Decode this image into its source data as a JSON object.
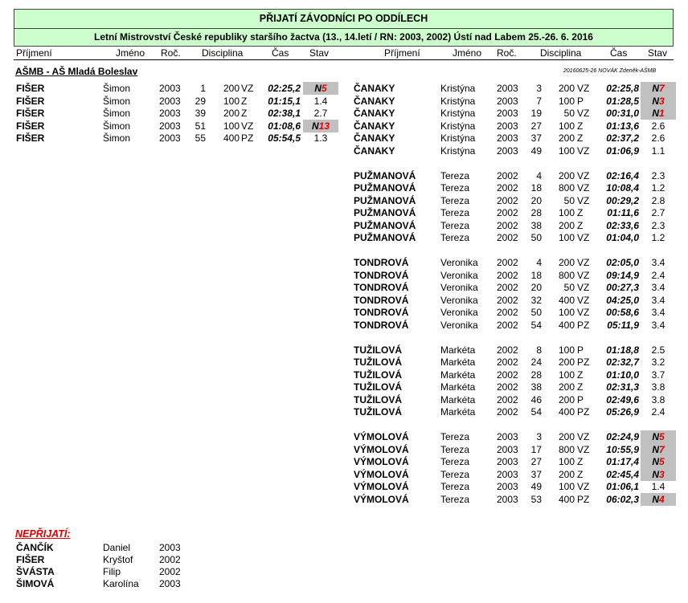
{
  "title": "PŘIJATÍ ZÁVODNÍCI PO ODDÍLECH",
  "subtitle": "Letní Mistrovství České republiky staršího žactva (13., 14.letí  / RN: 2003, 2002)   Ústí nad Labem 25.-26. 6. 2016",
  "columns": {
    "surname": "Příjmení",
    "name": "Jméno",
    "year": "Roč.",
    "discipline": "Disciplina",
    "time": "Čas",
    "status": "Stav"
  },
  "club": {
    "name": "AŠMB - AŠ Mladá Boleslav",
    "meta": "20160625-26 NOVÁK Zdeněk-AŠMB"
  },
  "left_entries": [
    {
      "surname": "FIŠER",
      "name": "Šimon",
      "year": "2003",
      "num": "1",
      "dist": "200",
      "stroke": "VZ",
      "time": "02:25,2",
      "status": {
        "type": "N",
        "prefix": "N",
        "rank": "5"
      }
    },
    {
      "surname": "FIŠER",
      "name": "Šimon",
      "year": "2003",
      "num": "29",
      "dist": "100",
      "stroke": "Z",
      "time": "01:15,1",
      "status": {
        "type": "val",
        "text": "1.4"
      }
    },
    {
      "surname": "FIŠER",
      "name": "Šimon",
      "year": "2003",
      "num": "39",
      "dist": "200",
      "stroke": "Z",
      "time": "02:38,1",
      "status": {
        "type": "val",
        "text": "2.7"
      }
    },
    {
      "surname": "FIŠER",
      "name": "Šimon",
      "year": "2003",
      "num": "51",
      "dist": "100",
      "stroke": "VZ",
      "time": "01:08,6",
      "status": {
        "type": "N",
        "prefix": "N",
        "rank": "13"
      }
    },
    {
      "surname": "FIŠER",
      "name": "Šimon",
      "year": "2003",
      "num": "55",
      "dist": "400",
      "stroke": "PZ",
      "time": "05:54,5",
      "status": {
        "type": "val",
        "text": "1.3"
      }
    }
  ],
  "right_groups": [
    {
      "entries": [
        {
          "surname": "ČANAKY",
          "name": "Kristýna",
          "year": "2003",
          "num": "3",
          "dist": "200",
          "stroke": "VZ",
          "time": "02:25,8",
          "status": {
            "type": "N",
            "prefix": "N",
            "rank": "7"
          }
        },
        {
          "surname": "ČANAKY",
          "name": "Kristýna",
          "year": "2003",
          "num": "7",
          "dist": "100",
          "stroke": "P",
          "time": "01:28,5",
          "status": {
            "type": "N",
            "prefix": "N",
            "rank": "3"
          }
        },
        {
          "surname": "ČANAKY",
          "name": "Kristýna",
          "year": "2003",
          "num": "19",
          "dist": "50",
          "stroke": "VZ",
          "time": "00:31,0",
          "status": {
            "type": "N",
            "prefix": "N",
            "rank": "1"
          }
        },
        {
          "surname": "ČANAKY",
          "name": "Kristýna",
          "year": "2003",
          "num": "27",
          "dist": "100",
          "stroke": "Z",
          "time": "01:13,6",
          "status": {
            "type": "val",
            "text": "2.6"
          }
        },
        {
          "surname": "ČANAKY",
          "name": "Kristýna",
          "year": "2003",
          "num": "37",
          "dist": "200",
          "stroke": "Z",
          "time": "02:37,2",
          "status": {
            "type": "val",
            "text": "2.6"
          }
        },
        {
          "surname": "ČANAKY",
          "name": "Kristýna",
          "year": "2003",
          "num": "49",
          "dist": "100",
          "stroke": "VZ",
          "time": "01:06,9",
          "status": {
            "type": "val",
            "text": "1.1"
          }
        }
      ]
    },
    {
      "entries": [
        {
          "surname": "PUŽMANOVÁ",
          "name": "Tereza",
          "year": "2002",
          "num": "4",
          "dist": "200",
          "stroke": "VZ",
          "time": "02:16,4",
          "status": {
            "type": "val",
            "text": "2.3"
          }
        },
        {
          "surname": "PUŽMANOVÁ",
          "name": "Tereza",
          "year": "2002",
          "num": "18",
          "dist": "800",
          "stroke": "VZ",
          "time": "10:08,4",
          "status": {
            "type": "val",
            "text": "1.2"
          }
        },
        {
          "surname": "PUŽMANOVÁ",
          "name": "Tereza",
          "year": "2002",
          "num": "20",
          "dist": "50",
          "stroke": "VZ",
          "time": "00:29,2",
          "status": {
            "type": "val",
            "text": "2.8"
          }
        },
        {
          "surname": "PUŽMANOVÁ",
          "name": "Tereza",
          "year": "2002",
          "num": "28",
          "dist": "100",
          "stroke": "Z",
          "time": "01:11,6",
          "status": {
            "type": "val",
            "text": "2.7"
          }
        },
        {
          "surname": "PUŽMANOVÁ",
          "name": "Tereza",
          "year": "2002",
          "num": "38",
          "dist": "200",
          "stroke": "Z",
          "time": "02:33,6",
          "status": {
            "type": "val",
            "text": "2.3"
          }
        },
        {
          "surname": "PUŽMANOVÁ",
          "name": "Tereza",
          "year": "2002",
          "num": "50",
          "dist": "100",
          "stroke": "VZ",
          "time": "01:04,0",
          "status": {
            "type": "val",
            "text": "1.2"
          }
        }
      ]
    },
    {
      "entries": [
        {
          "surname": "TONDROVÁ",
          "name": "Veronika",
          "year": "2002",
          "num": "4",
          "dist": "200",
          "stroke": "VZ",
          "time": "02:05,0",
          "status": {
            "type": "val",
            "text": "3.4"
          }
        },
        {
          "surname": "TONDROVÁ",
          "name": "Veronika",
          "year": "2002",
          "num": "18",
          "dist": "800",
          "stroke": "VZ",
          "time": "09:14,9",
          "status": {
            "type": "val",
            "text": "2.4"
          }
        },
        {
          "surname": "TONDROVÁ",
          "name": "Veronika",
          "year": "2002",
          "num": "20",
          "dist": "50",
          "stroke": "VZ",
          "time": "00:27,3",
          "status": {
            "type": "val",
            "text": "3.4"
          }
        },
        {
          "surname": "TONDROVÁ",
          "name": "Veronika",
          "year": "2002",
          "num": "32",
          "dist": "400",
          "stroke": "VZ",
          "time": "04:25,0",
          "status": {
            "type": "val",
            "text": "3.4"
          }
        },
        {
          "surname": "TONDROVÁ",
          "name": "Veronika",
          "year": "2002",
          "num": "50",
          "dist": "100",
          "stroke": "VZ",
          "time": "00:58,6",
          "status": {
            "type": "val",
            "text": "3.4"
          }
        },
        {
          "surname": "TONDROVÁ",
          "name": "Veronika",
          "year": "2002",
          "num": "54",
          "dist": "400",
          "stroke": "PZ",
          "time": "05:11,9",
          "status": {
            "type": "val",
            "text": "3.4"
          }
        }
      ]
    },
    {
      "entries": [
        {
          "surname": "TUŽILOVÁ",
          "name": "Markéta",
          "year": "2002",
          "num": "8",
          "dist": "100",
          "stroke": "P",
          "time": "01:18,8",
          "status": {
            "type": "val",
            "text": "2.5"
          }
        },
        {
          "surname": "TUŽILOVÁ",
          "name": "Markéta",
          "year": "2002",
          "num": "24",
          "dist": "200",
          "stroke": "PZ",
          "time": "02:32,7",
          "status": {
            "type": "val",
            "text": "3.2"
          }
        },
        {
          "surname": "TUŽILOVÁ",
          "name": "Markéta",
          "year": "2002",
          "num": "28",
          "dist": "100",
          "stroke": "Z",
          "time": "01:10,0",
          "status": {
            "type": "val",
            "text": "3.7"
          }
        },
        {
          "surname": "TUŽILOVÁ",
          "name": "Markéta",
          "year": "2002",
          "num": "38",
          "dist": "200",
          "stroke": "Z",
          "time": "02:31,3",
          "status": {
            "type": "val",
            "text": "3.8"
          }
        },
        {
          "surname": "TUŽILOVÁ",
          "name": "Markéta",
          "year": "2002",
          "num": "46",
          "dist": "200",
          "stroke": "P",
          "time": "02:49,6",
          "status": {
            "type": "val",
            "text": "3.8"
          }
        },
        {
          "surname": "TUŽILOVÁ",
          "name": "Markéta",
          "year": "2002",
          "num": "54",
          "dist": "400",
          "stroke": "PZ",
          "time": "05:26,9",
          "status": {
            "type": "val",
            "text": "2.4"
          }
        }
      ]
    },
    {
      "entries": [
        {
          "surname": "VÝMOLOVÁ",
          "name": "Tereza",
          "year": "2003",
          "num": "3",
          "dist": "200",
          "stroke": "VZ",
          "time": "02:24,9",
          "status": {
            "type": "N",
            "prefix": "N",
            "rank": "5"
          }
        },
        {
          "surname": "VÝMOLOVÁ",
          "name": "Tereza",
          "year": "2003",
          "num": "17",
          "dist": "800",
          "stroke": "VZ",
          "time": "10:55,9",
          "status": {
            "type": "N",
            "prefix": "N",
            "rank": "7"
          }
        },
        {
          "surname": "VÝMOLOVÁ",
          "name": "Tereza",
          "year": "2003",
          "num": "27",
          "dist": "100",
          "stroke": "Z",
          "time": "01:17,4",
          "status": {
            "type": "N",
            "prefix": "N",
            "rank": "5"
          }
        },
        {
          "surname": "VÝMOLOVÁ",
          "name": "Tereza",
          "year": "2003",
          "num": "37",
          "dist": "200",
          "stroke": "Z",
          "time": "02:45,4",
          "status": {
            "type": "N",
            "prefix": "N",
            "rank": "3"
          }
        },
        {
          "surname": "VÝMOLOVÁ",
          "name": "Tereza",
          "year": "2003",
          "num": "49",
          "dist": "100",
          "stroke": "VZ",
          "time": "01:06,1",
          "status": {
            "type": "val",
            "text": "1.4"
          }
        },
        {
          "surname": "VÝMOLOVÁ",
          "name": "Tereza",
          "year": "2003",
          "num": "53",
          "dist": "400",
          "stroke": "PZ",
          "time": "06:02,3",
          "status": {
            "type": "N",
            "prefix": "N",
            "rank": "4"
          }
        }
      ]
    }
  ],
  "not_accepted": {
    "title": "NEPŘIJATÍ:",
    "entries": [
      {
        "surname": "ČANČÍK",
        "name": "Daniel",
        "year": "2003"
      },
      {
        "surname": "FIŠER",
        "name": "Kryštof",
        "year": "2002"
      },
      {
        "surname": "ŠVÁSTA",
        "name": "Filip",
        "year": "2002"
      },
      {
        "surname": "ŠIMOVÁ",
        "name": "Karolína",
        "year": "2003"
      }
    ]
  },
  "colors": {
    "banner_bg": "#ccffcc",
    "status_highlight": "#c0c0c0",
    "rank_red": "#e00000"
  }
}
